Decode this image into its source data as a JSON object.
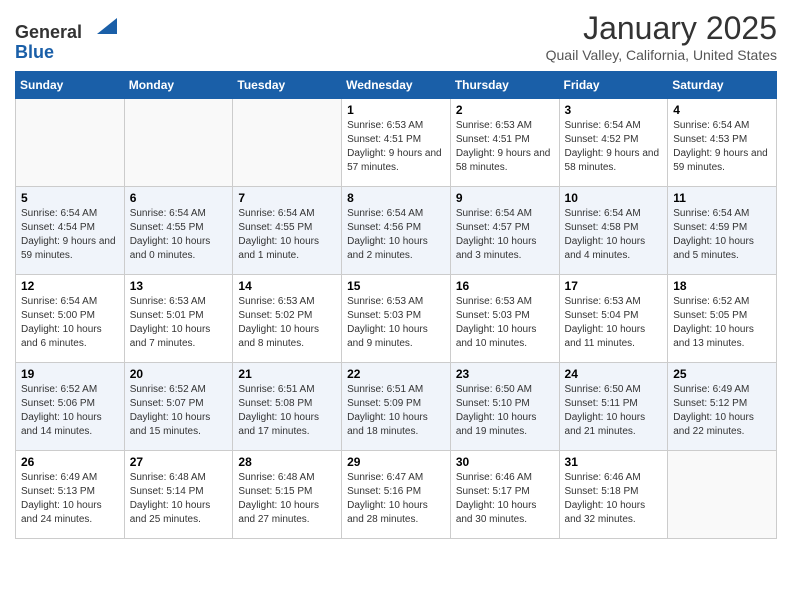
{
  "header": {
    "logo_line1": "General",
    "logo_line2": "Blue",
    "month": "January 2025",
    "location": "Quail Valley, California, United States"
  },
  "days_of_week": [
    "Sunday",
    "Monday",
    "Tuesday",
    "Wednesday",
    "Thursday",
    "Friday",
    "Saturday"
  ],
  "weeks": [
    [
      {
        "day": "",
        "info": ""
      },
      {
        "day": "",
        "info": ""
      },
      {
        "day": "",
        "info": ""
      },
      {
        "day": "1",
        "info": "Sunrise: 6:53 AM\nSunset: 4:51 PM\nDaylight: 9 hours\nand 57 minutes."
      },
      {
        "day": "2",
        "info": "Sunrise: 6:53 AM\nSunset: 4:51 PM\nDaylight: 9 hours\nand 58 minutes."
      },
      {
        "day": "3",
        "info": "Sunrise: 6:54 AM\nSunset: 4:52 PM\nDaylight: 9 hours\nand 58 minutes."
      },
      {
        "day": "4",
        "info": "Sunrise: 6:54 AM\nSunset: 4:53 PM\nDaylight: 9 hours\nand 59 minutes."
      }
    ],
    [
      {
        "day": "5",
        "info": "Sunrise: 6:54 AM\nSunset: 4:54 PM\nDaylight: 9 hours\nand 59 minutes."
      },
      {
        "day": "6",
        "info": "Sunrise: 6:54 AM\nSunset: 4:55 PM\nDaylight: 10 hours\nand 0 minutes."
      },
      {
        "day": "7",
        "info": "Sunrise: 6:54 AM\nSunset: 4:55 PM\nDaylight: 10 hours\nand 1 minute."
      },
      {
        "day": "8",
        "info": "Sunrise: 6:54 AM\nSunset: 4:56 PM\nDaylight: 10 hours\nand 2 minutes."
      },
      {
        "day": "9",
        "info": "Sunrise: 6:54 AM\nSunset: 4:57 PM\nDaylight: 10 hours\nand 3 minutes."
      },
      {
        "day": "10",
        "info": "Sunrise: 6:54 AM\nSunset: 4:58 PM\nDaylight: 10 hours\nand 4 minutes."
      },
      {
        "day": "11",
        "info": "Sunrise: 6:54 AM\nSunset: 4:59 PM\nDaylight: 10 hours\nand 5 minutes."
      }
    ],
    [
      {
        "day": "12",
        "info": "Sunrise: 6:54 AM\nSunset: 5:00 PM\nDaylight: 10 hours\nand 6 minutes."
      },
      {
        "day": "13",
        "info": "Sunrise: 6:53 AM\nSunset: 5:01 PM\nDaylight: 10 hours\nand 7 minutes."
      },
      {
        "day": "14",
        "info": "Sunrise: 6:53 AM\nSunset: 5:02 PM\nDaylight: 10 hours\nand 8 minutes."
      },
      {
        "day": "15",
        "info": "Sunrise: 6:53 AM\nSunset: 5:03 PM\nDaylight: 10 hours\nand 9 minutes."
      },
      {
        "day": "16",
        "info": "Sunrise: 6:53 AM\nSunset: 5:03 PM\nDaylight: 10 hours\nand 10 minutes."
      },
      {
        "day": "17",
        "info": "Sunrise: 6:53 AM\nSunset: 5:04 PM\nDaylight: 10 hours\nand 11 minutes."
      },
      {
        "day": "18",
        "info": "Sunrise: 6:52 AM\nSunset: 5:05 PM\nDaylight: 10 hours\nand 13 minutes."
      }
    ],
    [
      {
        "day": "19",
        "info": "Sunrise: 6:52 AM\nSunset: 5:06 PM\nDaylight: 10 hours\nand 14 minutes."
      },
      {
        "day": "20",
        "info": "Sunrise: 6:52 AM\nSunset: 5:07 PM\nDaylight: 10 hours\nand 15 minutes."
      },
      {
        "day": "21",
        "info": "Sunrise: 6:51 AM\nSunset: 5:08 PM\nDaylight: 10 hours\nand 17 minutes."
      },
      {
        "day": "22",
        "info": "Sunrise: 6:51 AM\nSunset: 5:09 PM\nDaylight: 10 hours\nand 18 minutes."
      },
      {
        "day": "23",
        "info": "Sunrise: 6:50 AM\nSunset: 5:10 PM\nDaylight: 10 hours\nand 19 minutes."
      },
      {
        "day": "24",
        "info": "Sunrise: 6:50 AM\nSunset: 5:11 PM\nDaylight: 10 hours\nand 21 minutes."
      },
      {
        "day": "25",
        "info": "Sunrise: 6:49 AM\nSunset: 5:12 PM\nDaylight: 10 hours\nand 22 minutes."
      }
    ],
    [
      {
        "day": "26",
        "info": "Sunrise: 6:49 AM\nSunset: 5:13 PM\nDaylight: 10 hours\nand 24 minutes."
      },
      {
        "day": "27",
        "info": "Sunrise: 6:48 AM\nSunset: 5:14 PM\nDaylight: 10 hours\nand 25 minutes."
      },
      {
        "day": "28",
        "info": "Sunrise: 6:48 AM\nSunset: 5:15 PM\nDaylight: 10 hours\nand 27 minutes."
      },
      {
        "day": "29",
        "info": "Sunrise: 6:47 AM\nSunset: 5:16 PM\nDaylight: 10 hours\nand 28 minutes."
      },
      {
        "day": "30",
        "info": "Sunrise: 6:46 AM\nSunset: 5:17 PM\nDaylight: 10 hours\nand 30 minutes."
      },
      {
        "day": "31",
        "info": "Sunrise: 6:46 AM\nSunset: 5:18 PM\nDaylight: 10 hours\nand 32 minutes."
      },
      {
        "day": "",
        "info": ""
      }
    ]
  ]
}
